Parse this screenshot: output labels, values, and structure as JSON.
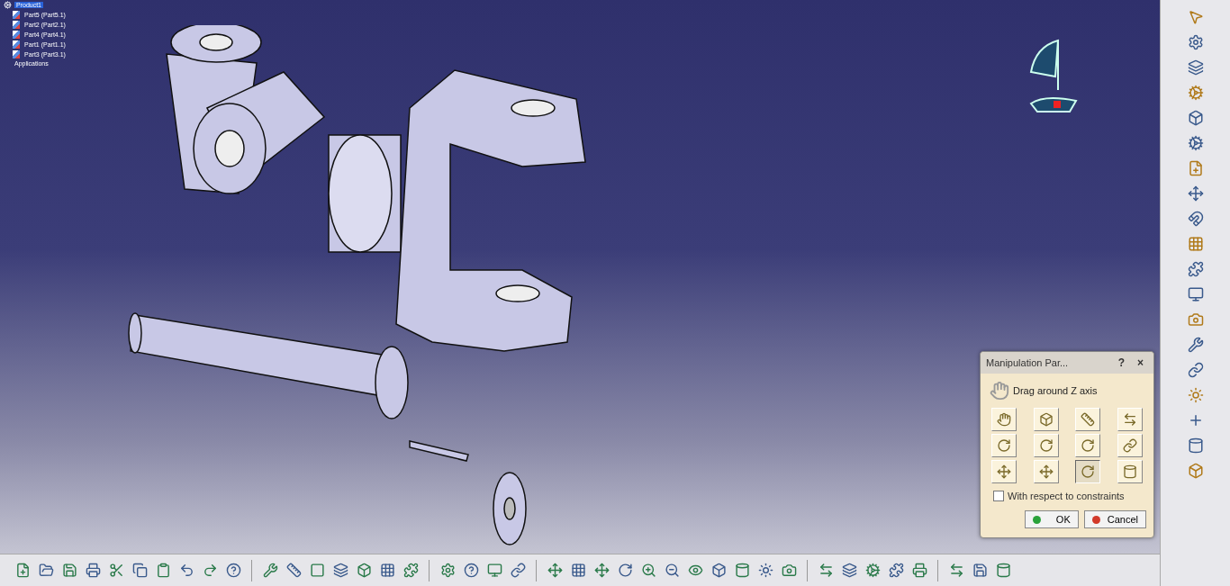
{
  "tree": {
    "root": {
      "label": "Product1",
      "selected": true
    },
    "children": [
      {
        "label": "Part5 (Part5.1)"
      },
      {
        "label": "Part2 (Part2.1)"
      },
      {
        "label": "Part4 (Part4.1)"
      },
      {
        "label": "Part1 (Part1.1)"
      },
      {
        "label": "Part3 (Part3.1)"
      }
    ],
    "footer": "Applications"
  },
  "dialog": {
    "title": "Manipulation Par...",
    "help": "?",
    "close": "×",
    "instruction": "Drag around Z axis",
    "tools": [
      {
        "selected": false
      },
      {
        "selected": false
      },
      {
        "selected": false
      },
      {
        "selected": false
      },
      {
        "selected": false
      },
      {
        "selected": false
      },
      {
        "selected": false
      },
      {
        "selected": false
      },
      {
        "selected": false
      },
      {
        "selected": false
      },
      {
        "selected": true
      },
      {
        "selected": false
      }
    ],
    "constraint": {
      "label": "With respect to constraints",
      "checked": false
    },
    "buttons": [
      {
        "kind": "ok",
        "label": "OK"
      },
      {
        "kind": "cancel",
        "label": "Cancel"
      }
    ]
  }
}
